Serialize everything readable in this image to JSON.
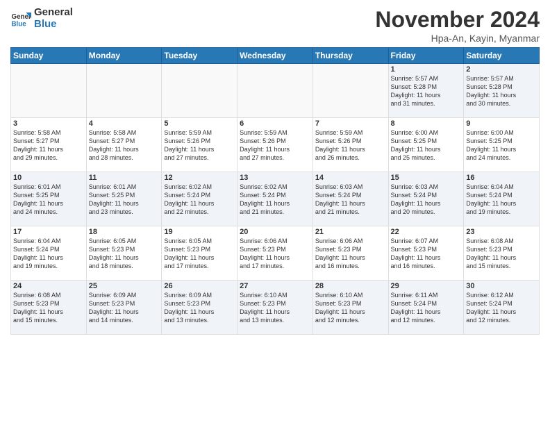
{
  "logo": {
    "line1": "General",
    "line2": "Blue"
  },
  "title": "November 2024",
  "subtitle": "Hpa-An, Kayin, Myanmar",
  "days_of_week": [
    "Sunday",
    "Monday",
    "Tuesday",
    "Wednesday",
    "Thursday",
    "Friday",
    "Saturday"
  ],
  "weeks": [
    [
      {
        "day": "",
        "info": ""
      },
      {
        "day": "",
        "info": ""
      },
      {
        "day": "",
        "info": ""
      },
      {
        "day": "",
        "info": ""
      },
      {
        "day": "",
        "info": ""
      },
      {
        "day": "1",
        "info": "Sunrise: 5:57 AM\nSunset: 5:28 PM\nDaylight: 11 hours\nand 31 minutes."
      },
      {
        "day": "2",
        "info": "Sunrise: 5:57 AM\nSunset: 5:28 PM\nDaylight: 11 hours\nand 30 minutes."
      }
    ],
    [
      {
        "day": "3",
        "info": "Sunrise: 5:58 AM\nSunset: 5:27 PM\nDaylight: 11 hours\nand 29 minutes."
      },
      {
        "day": "4",
        "info": "Sunrise: 5:58 AM\nSunset: 5:27 PM\nDaylight: 11 hours\nand 28 minutes."
      },
      {
        "day": "5",
        "info": "Sunrise: 5:59 AM\nSunset: 5:26 PM\nDaylight: 11 hours\nand 27 minutes."
      },
      {
        "day": "6",
        "info": "Sunrise: 5:59 AM\nSunset: 5:26 PM\nDaylight: 11 hours\nand 27 minutes."
      },
      {
        "day": "7",
        "info": "Sunrise: 5:59 AM\nSunset: 5:26 PM\nDaylight: 11 hours\nand 26 minutes."
      },
      {
        "day": "8",
        "info": "Sunrise: 6:00 AM\nSunset: 5:25 PM\nDaylight: 11 hours\nand 25 minutes."
      },
      {
        "day": "9",
        "info": "Sunrise: 6:00 AM\nSunset: 5:25 PM\nDaylight: 11 hours\nand 24 minutes."
      }
    ],
    [
      {
        "day": "10",
        "info": "Sunrise: 6:01 AM\nSunset: 5:25 PM\nDaylight: 11 hours\nand 24 minutes."
      },
      {
        "day": "11",
        "info": "Sunrise: 6:01 AM\nSunset: 5:25 PM\nDaylight: 11 hours\nand 23 minutes."
      },
      {
        "day": "12",
        "info": "Sunrise: 6:02 AM\nSunset: 5:24 PM\nDaylight: 11 hours\nand 22 minutes."
      },
      {
        "day": "13",
        "info": "Sunrise: 6:02 AM\nSunset: 5:24 PM\nDaylight: 11 hours\nand 21 minutes."
      },
      {
        "day": "14",
        "info": "Sunrise: 6:03 AM\nSunset: 5:24 PM\nDaylight: 11 hours\nand 21 minutes."
      },
      {
        "day": "15",
        "info": "Sunrise: 6:03 AM\nSunset: 5:24 PM\nDaylight: 11 hours\nand 20 minutes."
      },
      {
        "day": "16",
        "info": "Sunrise: 6:04 AM\nSunset: 5:24 PM\nDaylight: 11 hours\nand 19 minutes."
      }
    ],
    [
      {
        "day": "17",
        "info": "Sunrise: 6:04 AM\nSunset: 5:24 PM\nDaylight: 11 hours\nand 19 minutes."
      },
      {
        "day": "18",
        "info": "Sunrise: 6:05 AM\nSunset: 5:23 PM\nDaylight: 11 hours\nand 18 minutes."
      },
      {
        "day": "19",
        "info": "Sunrise: 6:05 AM\nSunset: 5:23 PM\nDaylight: 11 hours\nand 17 minutes."
      },
      {
        "day": "20",
        "info": "Sunrise: 6:06 AM\nSunset: 5:23 PM\nDaylight: 11 hours\nand 17 minutes."
      },
      {
        "day": "21",
        "info": "Sunrise: 6:06 AM\nSunset: 5:23 PM\nDaylight: 11 hours\nand 16 minutes."
      },
      {
        "day": "22",
        "info": "Sunrise: 6:07 AM\nSunset: 5:23 PM\nDaylight: 11 hours\nand 16 minutes."
      },
      {
        "day": "23",
        "info": "Sunrise: 6:08 AM\nSunset: 5:23 PM\nDaylight: 11 hours\nand 15 minutes."
      }
    ],
    [
      {
        "day": "24",
        "info": "Sunrise: 6:08 AM\nSunset: 5:23 PM\nDaylight: 11 hours\nand 15 minutes."
      },
      {
        "day": "25",
        "info": "Sunrise: 6:09 AM\nSunset: 5:23 PM\nDaylight: 11 hours\nand 14 minutes."
      },
      {
        "day": "26",
        "info": "Sunrise: 6:09 AM\nSunset: 5:23 PM\nDaylight: 11 hours\nand 13 minutes."
      },
      {
        "day": "27",
        "info": "Sunrise: 6:10 AM\nSunset: 5:23 PM\nDaylight: 11 hours\nand 13 minutes."
      },
      {
        "day": "28",
        "info": "Sunrise: 6:10 AM\nSunset: 5:23 PM\nDaylight: 11 hours\nand 12 minutes."
      },
      {
        "day": "29",
        "info": "Sunrise: 6:11 AM\nSunset: 5:24 PM\nDaylight: 11 hours\nand 12 minutes."
      },
      {
        "day": "30",
        "info": "Sunrise: 6:12 AM\nSunset: 5:24 PM\nDaylight: 11 hours\nand 12 minutes."
      }
    ]
  ]
}
